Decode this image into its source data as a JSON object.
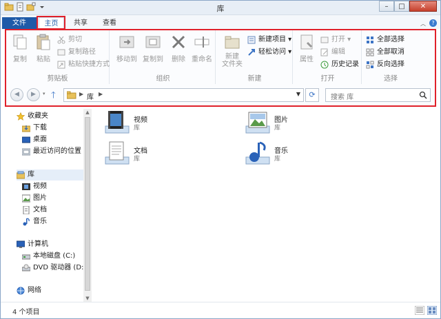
{
  "window": {
    "title": "库",
    "minimize": "–",
    "maximize": "□",
    "close": "✕"
  },
  "tabs": {
    "file": "文件",
    "home": "主页",
    "share": "共享",
    "view": "查看",
    "help": "?"
  },
  "ribbon": {
    "clipboard": {
      "label": "剪贴板",
      "copy": "复制",
      "paste": "粘贴",
      "cut": "剪切",
      "copy_path": "复制路径",
      "paste_shortcut": "粘贴快捷方式"
    },
    "organize": {
      "label": "组织",
      "move_to": "移动到",
      "copy_to": "复制到",
      "delete": "删除",
      "rename": "重命名"
    },
    "new": {
      "label": "新建",
      "new_folder": "新建\n文件夹",
      "new_item": "新建项目",
      "easy_access": "轻松访问"
    },
    "open": {
      "label": "打开",
      "properties": "属性",
      "open": "打开",
      "edit": "编辑",
      "history": "历史记录"
    },
    "select": {
      "label": "选择",
      "select_all": "全部选择",
      "select_none": "全部取消",
      "invert": "反向选择"
    }
  },
  "address": {
    "crumb": "库",
    "search_placeholder": "搜索 库"
  },
  "nav": {
    "favorites": "收藏夹",
    "downloads": "下载",
    "desktop": "桌面",
    "recent": "最近访问的位置",
    "libraries": "库",
    "videos": "视频",
    "pictures": "图片",
    "documents": "文档",
    "music": "音乐",
    "computer": "计算机",
    "local_disk": "本地磁盘 (C:)",
    "dvd": "DVD 驱动器 (D:)",
    "network": "网络"
  },
  "content": {
    "items": [
      {
        "name": "视频",
        "sub": "库"
      },
      {
        "name": "图片",
        "sub": "库"
      },
      {
        "name": "文档",
        "sub": "库"
      },
      {
        "name": "音乐",
        "sub": "库"
      }
    ]
  },
  "status": {
    "count": "4 个项目"
  },
  "colors": {
    "accent": "#1e5aa8",
    "highlight": "#e0202a"
  }
}
